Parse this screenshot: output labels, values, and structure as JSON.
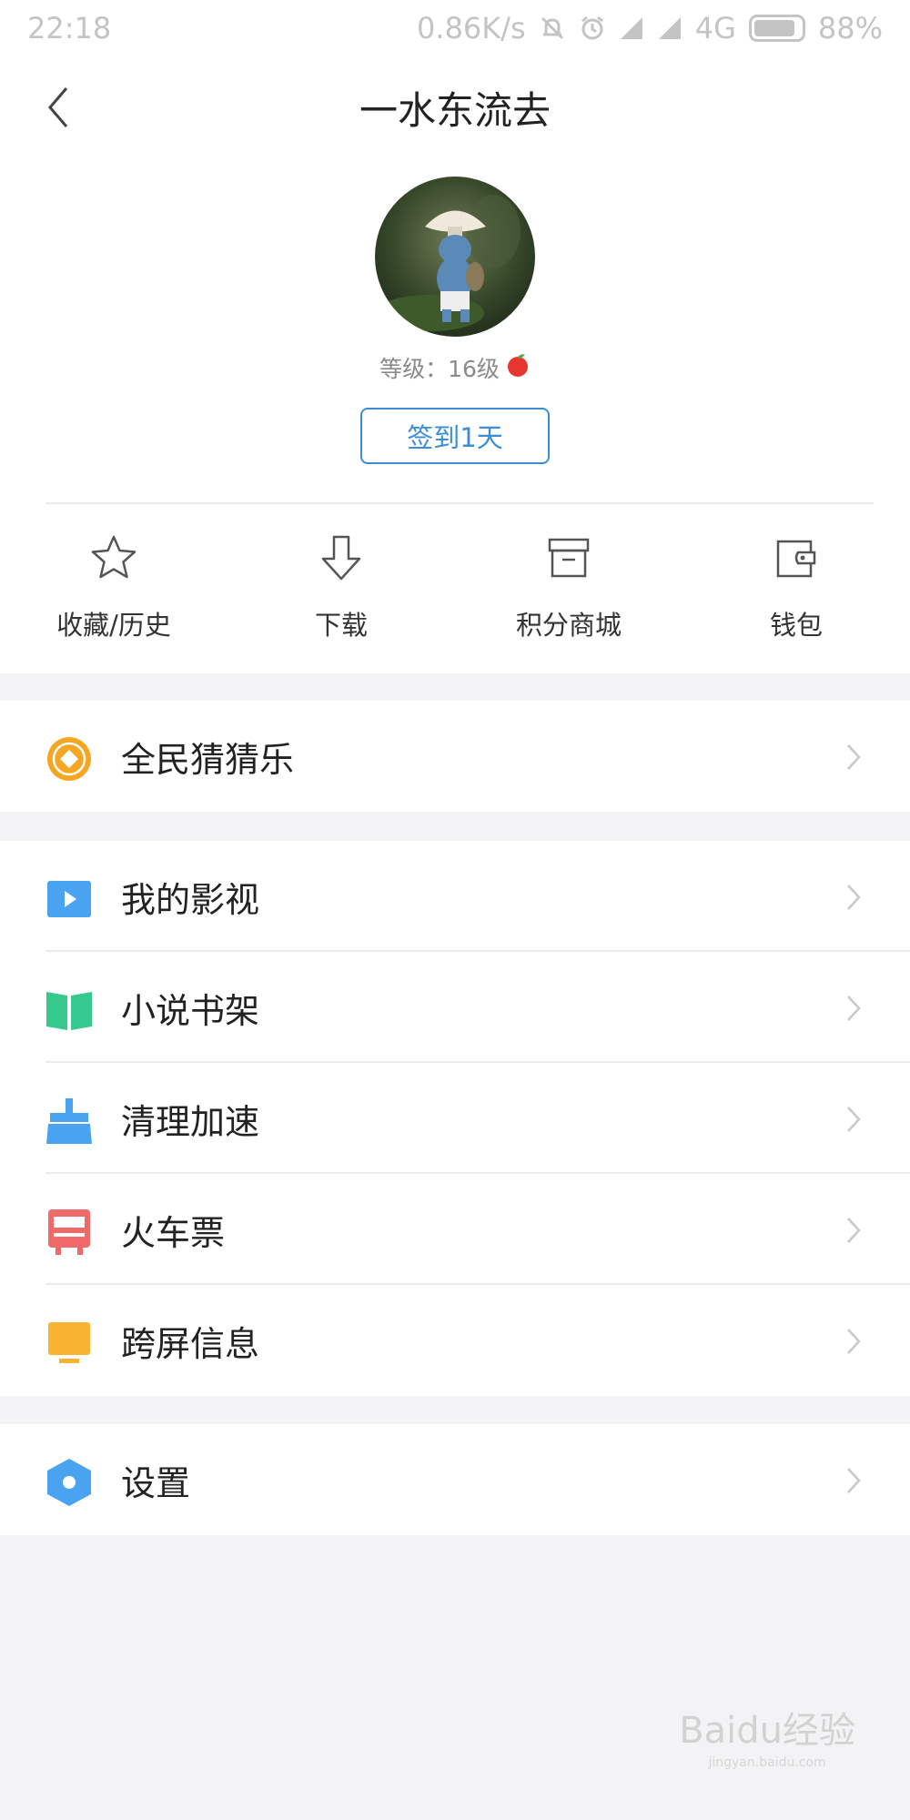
{
  "status_bar": {
    "time": "22:18",
    "net_speed": "0.86K/s",
    "network": "4G",
    "battery": "88%",
    "battery_level": 0.88
  },
  "header": {
    "title": "一水东流去"
  },
  "profile": {
    "level_text": "等级：16级",
    "signin_label": "签到1天"
  },
  "quick_actions": [
    {
      "label": "收藏/历史",
      "icon": "star-icon"
    },
    {
      "label": "下载",
      "icon": "download-icon"
    },
    {
      "label": "积分商城",
      "icon": "store-icon"
    },
    {
      "label": "钱包",
      "icon": "wallet-icon"
    }
  ],
  "menu_groups": [
    [
      {
        "label": "全民猜猜乐",
        "icon": "coin-icon",
        "color": "#f5a623"
      }
    ],
    [
      {
        "label": "我的影视",
        "icon": "video-play-icon",
        "color": "#4aa3f0"
      },
      {
        "label": "小说书架",
        "icon": "book-icon",
        "color": "#36c98d"
      },
      {
        "label": "清理加速",
        "icon": "broom-icon",
        "color": "#4aa3f0"
      },
      {
        "label": "火车票",
        "icon": "train-icon",
        "color": "#f06a6a"
      },
      {
        "label": "跨屏信息",
        "icon": "screen-icon",
        "color": "#f8b431"
      }
    ],
    [
      {
        "label": "设置",
        "icon": "settings-hex-icon",
        "color": "#4aa3f0"
      }
    ]
  ],
  "watermark": {
    "brand": "Baidu经验",
    "url": "jingyan.baidu.com"
  }
}
